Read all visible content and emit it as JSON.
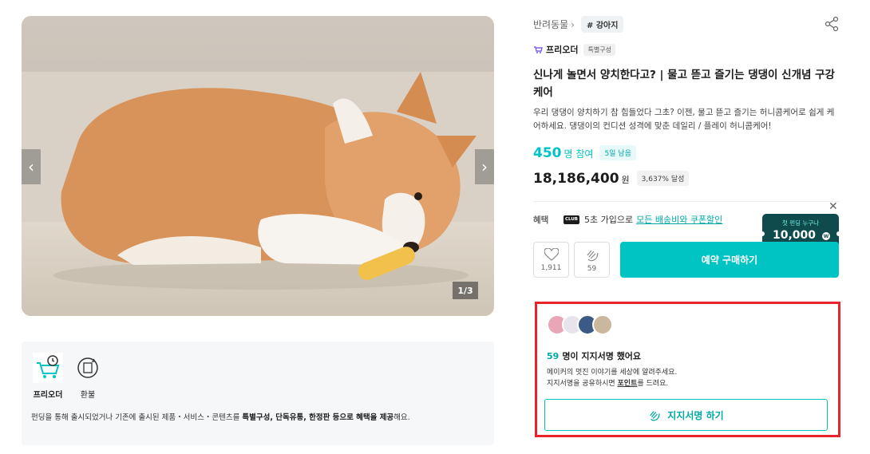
{
  "hero": {
    "counter": "1/3",
    "prev_icon": "chevron-left-icon",
    "next_icon": "chevron-right-icon"
  },
  "info_box": {
    "icons": [
      {
        "label": "프리오더",
        "icon": "cart-clock-icon"
      },
      {
        "label": "환불",
        "icon": "refund-icon"
      }
    ],
    "text_pre": "펀딩을 통해 출시되었거나 기존에 출시된 제품・서비스・콘텐츠를 ",
    "text_bold1": "특별구성, 단독유통, 한정판 등으로 혜택을 제공",
    "text_post": "해요."
  },
  "breadcrumb": {
    "category": "반려동물",
    "tag": "# 강아지"
  },
  "preorder": {
    "label": "프리오더",
    "badge": "특별구성"
  },
  "product": {
    "title": "신나게 놀면서 양치한다고? | 물고 뜯고 즐기는 댕댕이 신개념 구강케어",
    "description": "우리 댕댕이 양치하기 참 힘들었다 그초? 이젠, 물고 뜯고 즐기는 허니콤케어로 쉽게 케어하세요. 댕댕이의 컨디션 성격에 맞춘 데일리 / 플레이 허니콤케어!"
  },
  "stats": {
    "participants": "450",
    "participants_unit": "명 참여",
    "days_left": "5일 남음",
    "amount": "18,186,400",
    "amount_unit": "원",
    "achievement": "3,637% 달성"
  },
  "benefit": {
    "label": "혜택",
    "club": "CLUB",
    "text": "5초 가입으로",
    "link": "모든 배송비와 쿠폰할인"
  },
  "coupon": {
    "small": "첫 펀딩 누구나",
    "big": "10,000",
    "currency": "W"
  },
  "actions": {
    "like_count": "1,911",
    "clap_count": "59",
    "reserve_label": "예약 구매하기"
  },
  "support": {
    "count": "59",
    "title": "명이 지지서명 했어요",
    "line1": "메이커의 멋진 이야기를 세상에 알려주세요.",
    "line2_pre": "지지서명을 공유하시면 ",
    "line2_point": "포인트",
    "line2_post": "를 드려요.",
    "button": "지지서명 하기"
  },
  "colors": {
    "accent": "#00c4c4",
    "highlight_border": "#e8232b"
  }
}
